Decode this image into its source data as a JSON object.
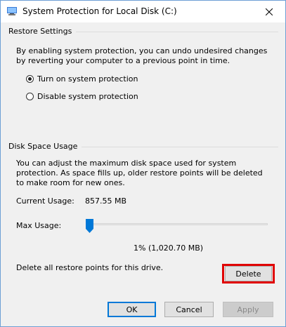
{
  "window": {
    "title": "System Protection for Local Disk (C:)"
  },
  "restore_settings": {
    "heading": "Restore Settings",
    "description": "By enabling system protection, you can undo undesired changes by reverting your computer to a previous point in time.",
    "options": [
      {
        "label": "Turn on system protection",
        "selected": true
      },
      {
        "label": "Disable system protection",
        "selected": false
      }
    ]
  },
  "disk_space": {
    "heading": "Disk Space Usage",
    "description": "You can adjust the maximum disk space used for system protection. As space fills up, older restore points will be deleted to make room for new ones.",
    "current_usage_label": "Current Usage:",
    "current_usage_value": "857.55 MB",
    "max_usage_label": "Max Usage:",
    "max_usage_percent": 1,
    "max_usage_caption": "1% (1,020.70 MB)",
    "delete_text": "Delete all restore points for this drive.",
    "delete_button": "Delete"
  },
  "footer": {
    "ok": "OK",
    "cancel": "Cancel",
    "apply": "Apply"
  },
  "colors": {
    "highlight": "#e00000",
    "slider_thumb": "#0078d7"
  }
}
